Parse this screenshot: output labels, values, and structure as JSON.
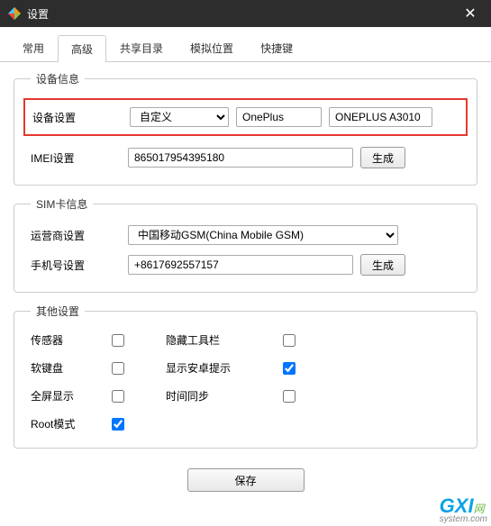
{
  "titlebar": {
    "title": "设置"
  },
  "tabs": [
    "常用",
    "高级",
    "共享目录",
    "模拟位置",
    "快捷键"
  ],
  "active_tab_index": 1,
  "device_info": {
    "legend": "设备信息",
    "device_setting_label": "设备设置",
    "device_setting_select": "自定义",
    "device_brand": "OnePlus",
    "device_model": "ONEPLUS A3010",
    "imei_label": "IMEI设置",
    "imei_value": "865017954395180",
    "generate_label": "生成"
  },
  "sim_info": {
    "legend": "SIM卡信息",
    "carrier_label": "运营商设置",
    "carrier_value": "中国移动GSM(China Mobile GSM)",
    "phone_label": "手机号设置",
    "phone_value": "+8617692557157",
    "generate_label": "生成"
  },
  "other": {
    "legend": "其他设置",
    "sensor": "传感器",
    "soft_keyboard": "软键盘",
    "fullscreen": "全屏显示",
    "root_mode": "Root模式",
    "hide_toolbar": "隐藏工具栏",
    "show_android_tip": "显示安卓提示",
    "time_sync": "时间同步",
    "root_checked": true,
    "tip_checked": true
  },
  "footer": {
    "save": "保存"
  },
  "watermark": {
    "brand1": "GXI",
    "brand2": "网",
    "sub": "system.com"
  }
}
